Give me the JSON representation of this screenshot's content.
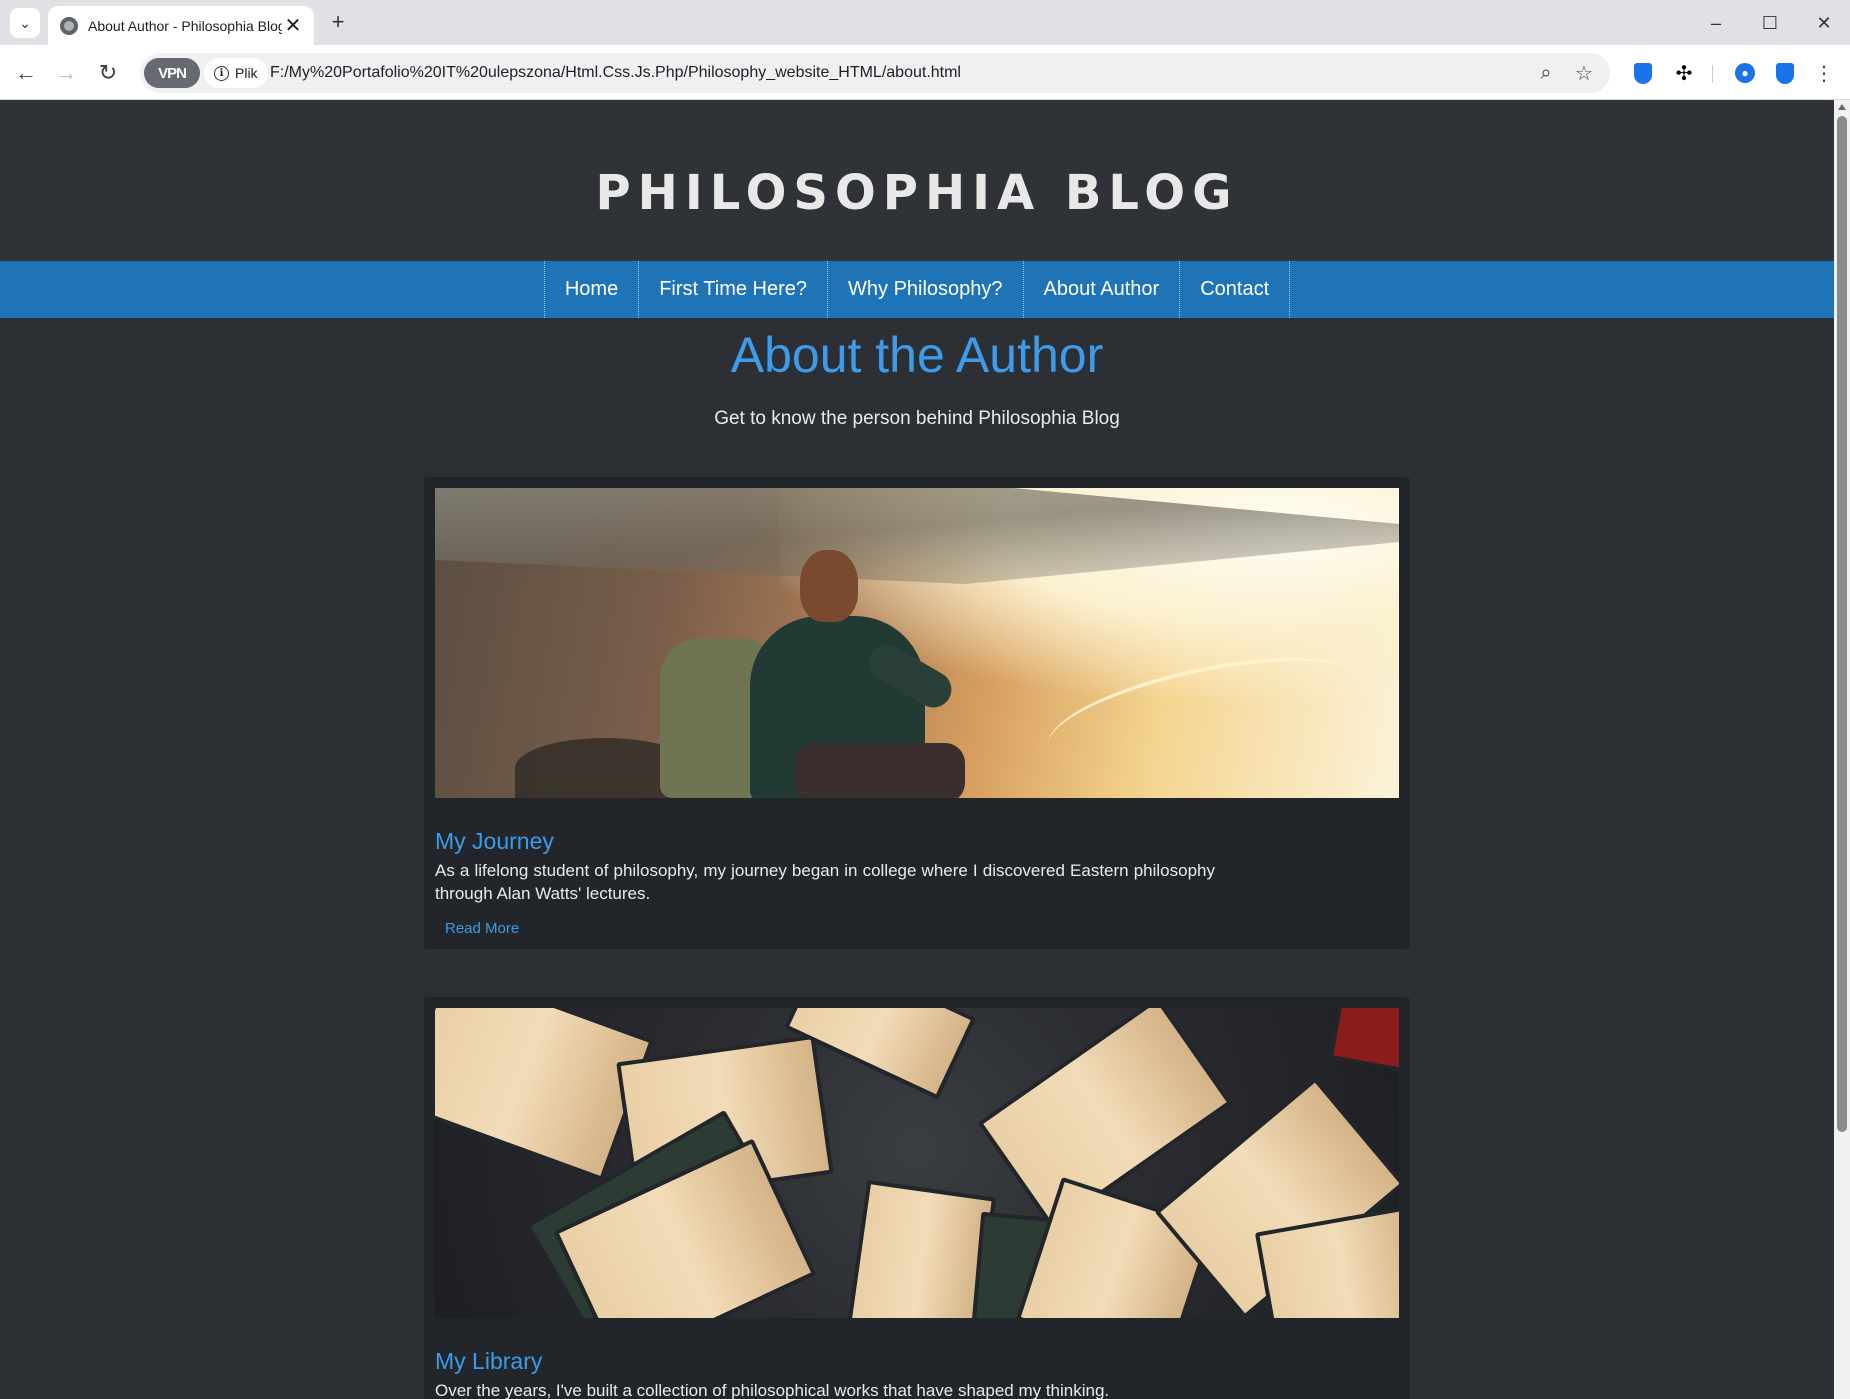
{
  "browser": {
    "tab_title": "About Author - Philosophia Blog",
    "tab_close": "✕",
    "new_tab": "+",
    "vpn_label": "VPN",
    "site_info_label": "Plik",
    "url": "F:/My%20Portafolio%20IT%20ulepszona/Html.Css.Js.Php/Philosophy_website_HTML/about.html",
    "icons": [
      "tab-search-icon",
      "back-arrow-icon",
      "forward-arrow-icon",
      "reload-icon",
      "zoom-icon",
      "star-icon",
      "extension-shield-icon",
      "puzzle-icon",
      "profile-icon",
      "bitwarden-shield-icon",
      "kebab-menu-icon",
      "minimize-icon",
      "maximize-icon",
      "close-window-icon"
    ]
  },
  "site": {
    "title": "PHILOSOPHIA BLOG",
    "nav": [
      "Home",
      "First Time Here?",
      "Why Philosophy?",
      "About Author",
      "Contact"
    ]
  },
  "page": {
    "heading": "About the Author",
    "subheading": "Get to know the person behind Philosophia Blog"
  },
  "cards": [
    {
      "title": "My Journey",
      "text": "As a lifelong student of philosophy, my journey began in college where I discovered Eastern philosophy through Alan Watts' lectures.",
      "link": "Read More",
      "image": "hiker-overlooking-valley"
    },
    {
      "title": "My Library",
      "text": "Over the years, I've built a collection of philosophical works that have shaped my thinking.",
      "image": "open-books-circle"
    }
  ],
  "colors": {
    "page_bg": "#2c3035",
    "nav_bg": "#1f73b7",
    "accent": "#3d9be9",
    "card_bg": "#22262b"
  }
}
